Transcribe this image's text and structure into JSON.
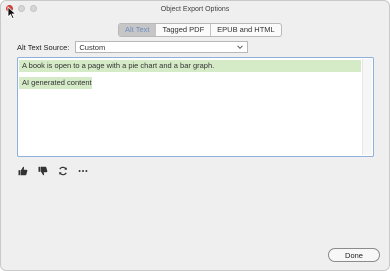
{
  "window": {
    "title": "Object Export Options"
  },
  "tabs": [
    {
      "label": "Alt Text",
      "active": true
    },
    {
      "label": "Tagged PDF",
      "active": false
    },
    {
      "label": "EPUB and HTML",
      "active": false
    }
  ],
  "alt_text_source": {
    "label": "Alt Text Source:",
    "selected": "Custom"
  },
  "alt_text": {
    "line1": "A book is open to a page with a pie chart and a bar graph.",
    "line2": "AI generated content"
  },
  "actions": {
    "icons": [
      "thumbs-up-icon",
      "thumbs-down-icon",
      "refresh-icon",
      "more-icon"
    ]
  },
  "footer": {
    "done_label": "Done"
  },
  "colors": {
    "highlight": "#d5ebc8",
    "focus_ring": "#8fb0dc",
    "active_tab_text": "#6d8fc0"
  }
}
